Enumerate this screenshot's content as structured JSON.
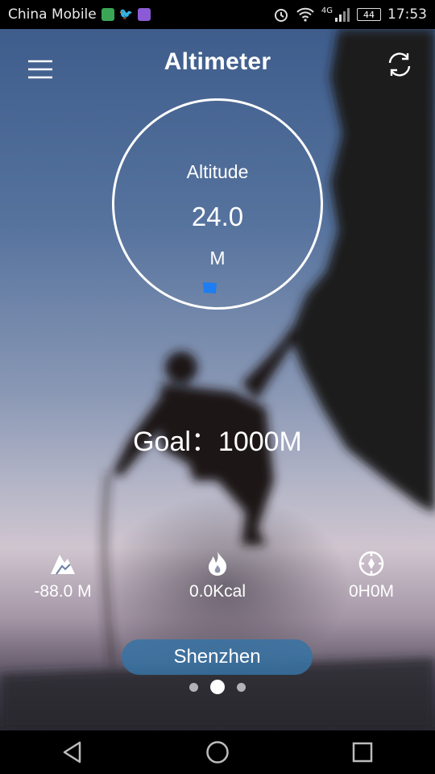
{
  "status_bar": {
    "carrier": "China Mobile",
    "network": "4G",
    "battery": "44",
    "time": "17:53"
  },
  "header": {
    "title": "Altimeter",
    "menu_icon": "hamburger-icon",
    "refresh_icon": "refresh-icon"
  },
  "altitude": {
    "label": "Altitude",
    "value": "24.0",
    "unit": "M",
    "flag_color": "#1e7df0"
  },
  "goal": {
    "label": "Goal：",
    "value": "1000M"
  },
  "stats": [
    {
      "icon": "mountain-icon",
      "value": "-88.0 M"
    },
    {
      "icon": "flame-icon",
      "value": "0.0Kcal"
    },
    {
      "icon": "compass-icon",
      "value": "0H0M"
    }
  ],
  "location": {
    "city": "Shenzhen"
  },
  "pager": {
    "count": 3,
    "active_index": 1
  },
  "nav": {
    "back_icon": "back-triangle-icon",
    "home_icon": "home-circle-icon",
    "recents_icon": "recents-square-icon"
  }
}
